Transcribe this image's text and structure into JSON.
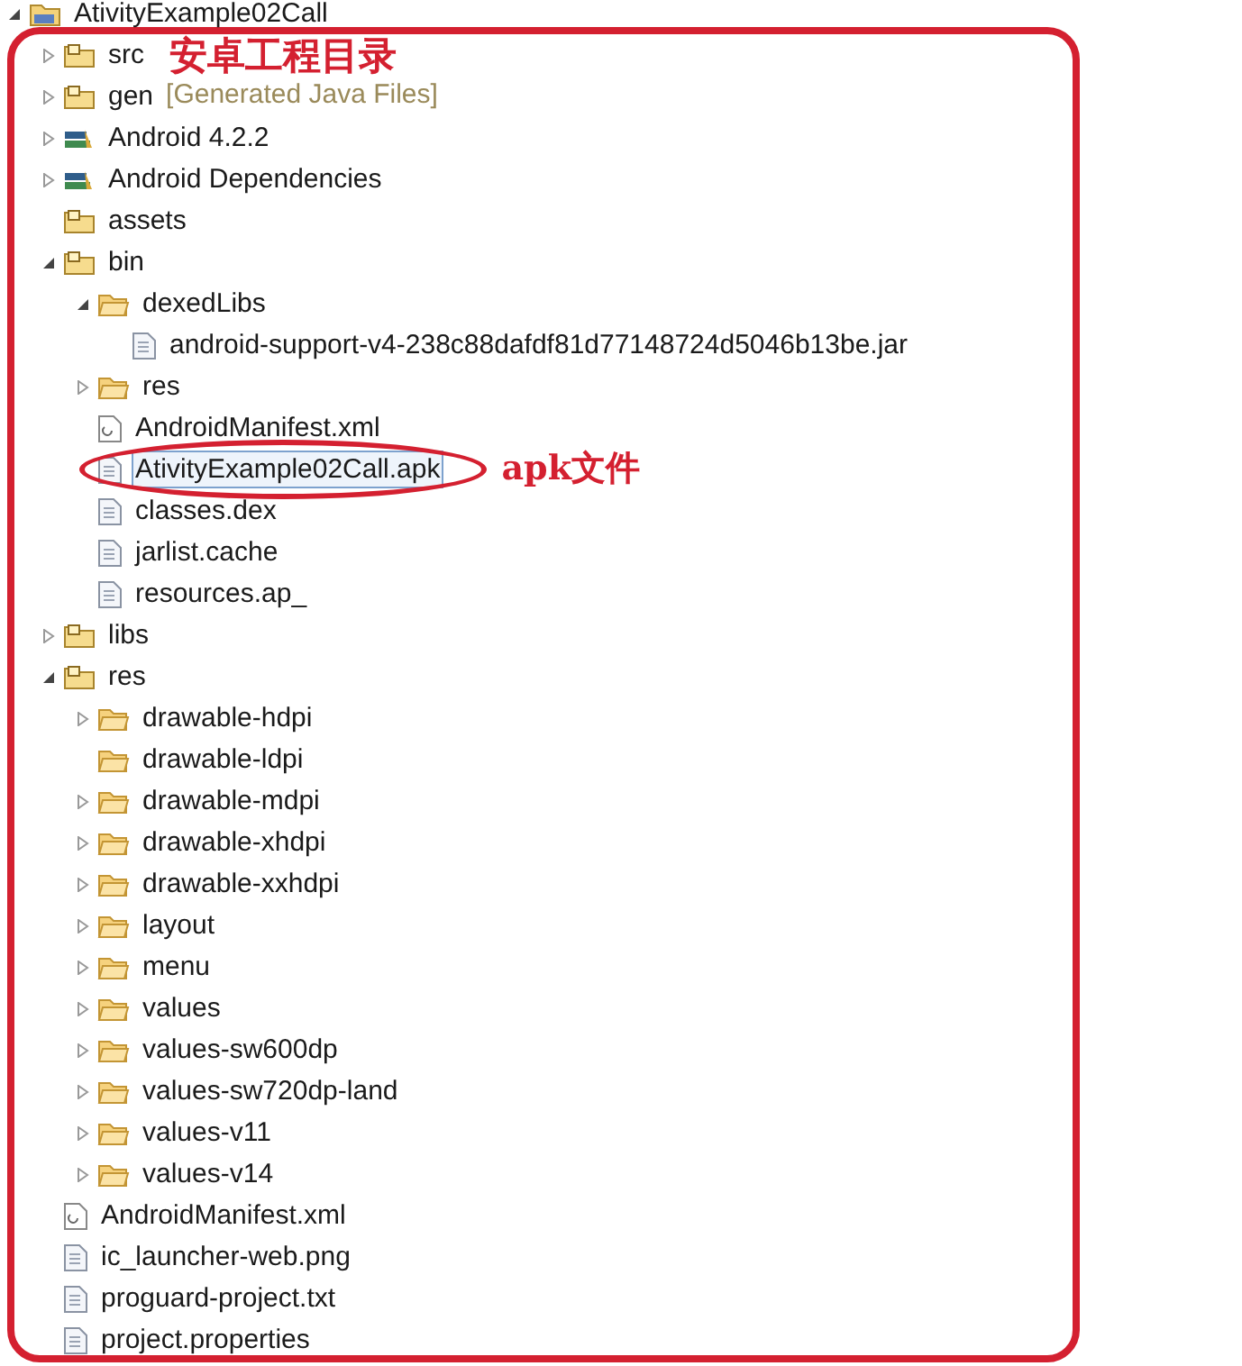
{
  "tree": [
    {
      "label": "AtivityExample02Call",
      "kind": "project",
      "expanded": true,
      "selected": false,
      "children": [
        {
          "label": "src",
          "kind": "source",
          "expanded": false,
          "selected": false,
          "note": "安卓工程目录"
        },
        {
          "label": "gen",
          "decoration": "[Generated Java Files]",
          "kind": "source",
          "expanded": false,
          "selected": false
        },
        {
          "label": "Android 4.2.2",
          "kind": "library",
          "expanded": false,
          "selected": false
        },
        {
          "label": "Android Dependencies",
          "kind": "library",
          "expanded": false,
          "selected": false
        },
        {
          "label": "assets",
          "kind": "source",
          "selected": false
        },
        {
          "label": "bin",
          "kind": "source",
          "expanded": true,
          "selected": false,
          "children": [
            {
              "label": "dexedLibs",
              "kind": "folder",
              "expanded": true,
              "selected": false,
              "children": [
                {
                  "label": "android-support-v4-238c88dafdf81d77148724d5046b13be.jar",
                  "kind": "file",
                  "selected": false
                }
              ]
            },
            {
              "label": "res",
              "kind": "folder",
              "expanded": false,
              "selected": false
            },
            {
              "label": "AndroidManifest.xml",
              "kind": "xml",
              "selected": false
            },
            {
              "label": "AtivityExample02Call.apk",
              "kind": "file",
              "selected": true,
              "note": "apk文件",
              "circled": true
            },
            {
              "label": "classes.dex",
              "kind": "file",
              "selected": false
            },
            {
              "label": "jarlist.cache",
              "kind": "file",
              "selected": false
            },
            {
              "label": "resources.ap_",
              "kind": "file",
              "selected": false
            }
          ]
        },
        {
          "label": "libs",
          "kind": "source",
          "expanded": false,
          "selected": false
        },
        {
          "label": "res",
          "kind": "source",
          "expanded": true,
          "selected": false,
          "children": [
            {
              "label": "drawable-hdpi",
              "kind": "folder",
              "expanded": false,
              "selected": false
            },
            {
              "label": "drawable-ldpi",
              "kind": "folder",
              "selected": false
            },
            {
              "label": "drawable-mdpi",
              "kind": "folder",
              "expanded": false,
              "selected": false
            },
            {
              "label": "drawable-xhdpi",
              "kind": "folder",
              "expanded": false,
              "selected": false
            },
            {
              "label": "drawable-xxhdpi",
              "kind": "folder",
              "expanded": false,
              "selected": false
            },
            {
              "label": "layout",
              "kind": "folder",
              "expanded": false,
              "selected": false
            },
            {
              "label": "menu",
              "kind": "folder",
              "expanded": false,
              "selected": false
            },
            {
              "label": "values",
              "kind": "folder",
              "expanded": false,
              "selected": false
            },
            {
              "label": "values-sw600dp",
              "kind": "folder",
              "expanded": false,
              "selected": false
            },
            {
              "label": "values-sw720dp-land",
              "kind": "folder",
              "expanded": false,
              "selected": false
            },
            {
              "label": "values-v11",
              "kind": "folder",
              "expanded": false,
              "selected": false
            },
            {
              "label": "values-v14",
              "kind": "folder",
              "expanded": false,
              "selected": false
            }
          ]
        },
        {
          "label": "AndroidManifest.xml",
          "kind": "xml",
          "selected": false
        },
        {
          "label": "ic_launcher-web.png",
          "kind": "file",
          "selected": false
        },
        {
          "label": "proguard-project.txt",
          "kind": "file",
          "selected": false
        },
        {
          "label": "project.properties",
          "kind": "file",
          "selected": false
        }
      ]
    }
  ]
}
